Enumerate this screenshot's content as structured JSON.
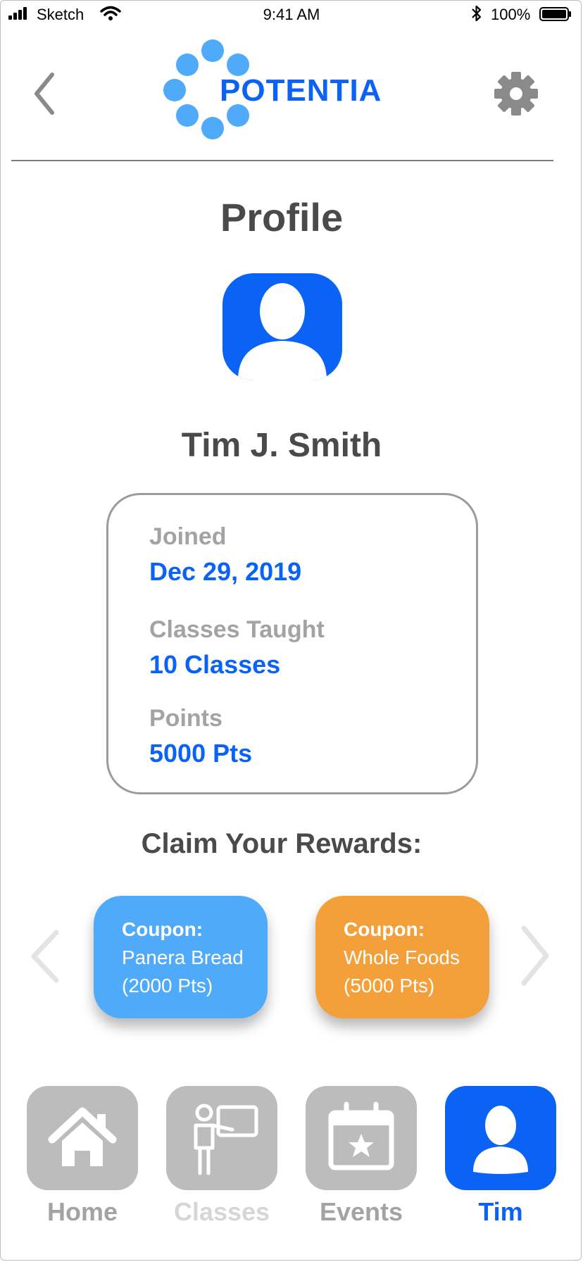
{
  "status_bar": {
    "carrier": "Sketch",
    "time": "9:41 AM",
    "battery": "100%"
  },
  "header": {
    "logo_text": "POTENTIA",
    "back_icon": "chevron-left-icon",
    "settings_icon": "gear-icon"
  },
  "colors": {
    "brand_blue": "#0b63f6",
    "logo_dot_blue": "#4faaf9",
    "coupon_blue": "#4faaf9",
    "coupon_orange": "#f4a03a",
    "nav_inactive": "#bcbcbc"
  },
  "page": {
    "title": "Profile",
    "avatar_icon": "user-icon",
    "name": "Tim J. Smith"
  },
  "stats": {
    "joined_label": "Joined",
    "joined_value": "Dec 29, 2019",
    "classes_label": "Classes Taught",
    "classes_value": "10 Classes",
    "points_label": "Points",
    "points_value": "5000 Pts"
  },
  "rewards": {
    "title": "Claim Your Rewards:",
    "coupons": [
      {
        "title": "Coupon:",
        "name": "Panera Bread",
        "cost": "(2000 Pts)"
      },
      {
        "title": "Coupon:",
        "name": "Whole Foods",
        "cost": "(5000 Pts)"
      }
    ]
  },
  "nav": {
    "items": [
      {
        "label": "Home",
        "icon": "home-icon",
        "active": false
      },
      {
        "label": "Classes",
        "icon": "teacher-icon",
        "active": false
      },
      {
        "label": "Events",
        "icon": "calendar-icon",
        "active": false
      },
      {
        "label": "Tim",
        "icon": "user-icon",
        "active": true
      }
    ]
  }
}
